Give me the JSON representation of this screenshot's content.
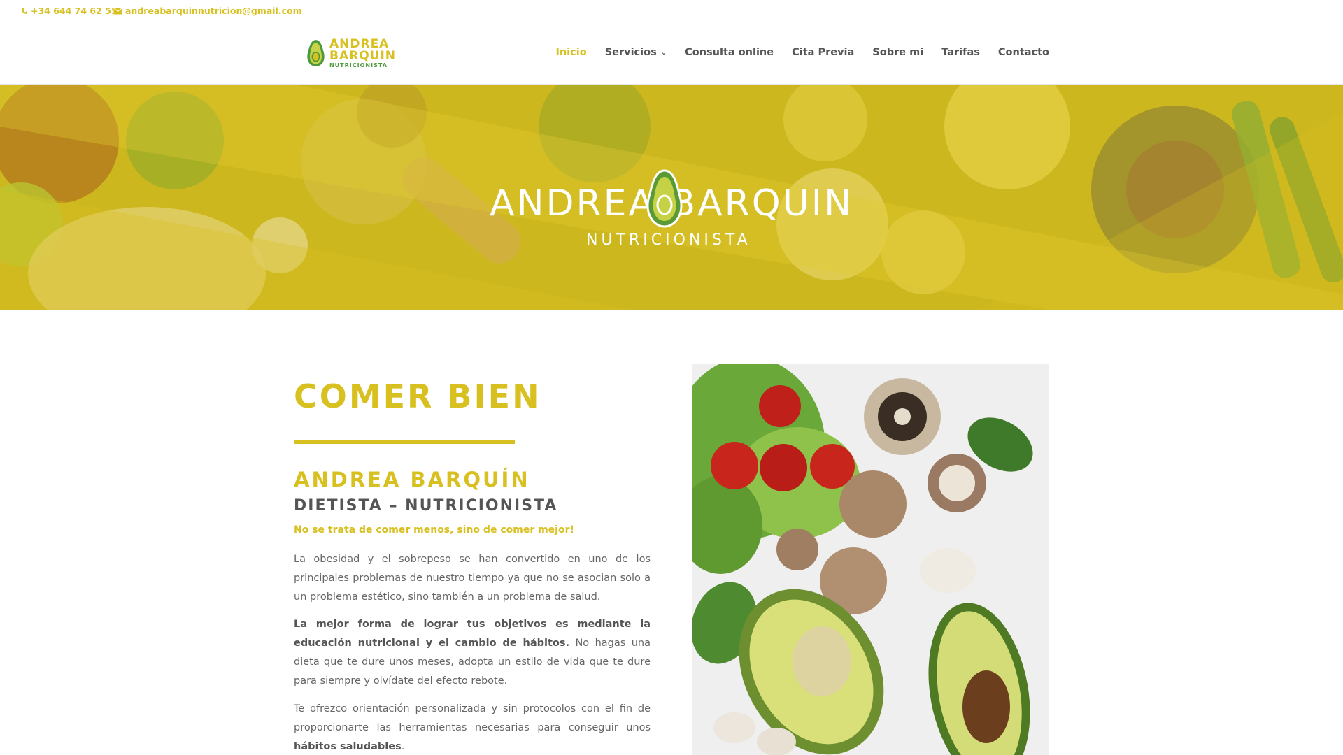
{
  "topbar": {
    "phone": "+34 644 74 62 55",
    "email": "andreabarquinnutricion@gmail.com",
    "phone_icon": "phone-icon",
    "email_icon": "envelope-icon"
  },
  "logo": {
    "line1": "ANDREA",
    "line2": "BARQUIN",
    "line3": "NUTRICIONISTA"
  },
  "nav": {
    "items": [
      {
        "label": "Inicio",
        "active": true
      },
      {
        "label": "Servicios",
        "dropdown": true
      },
      {
        "label": "Consulta online"
      },
      {
        "label": "Cita Previa"
      },
      {
        "label": "Sobre mi"
      },
      {
        "label": "Tarifas"
      },
      {
        "label": "Contacto"
      }
    ]
  },
  "hero": {
    "title_left": "ANDREA",
    "title_right": "BARQUIN",
    "subtitle": "NUTRICIONISTA"
  },
  "main": {
    "heading": "COMER BIEN",
    "name": "ANDREA BARQUÍN",
    "role": "DIETISTA – NUTRICIONISTA",
    "tagline": "No se trata de comer menos, sino de comer mejor!",
    "p1": "La obesidad y el sobrepeso se han convertido en uno de los principales problemas de nuestro tiempo ya que no se asocian solo a un problema estético, sino también a un problema de salud.",
    "p2_bold": "La mejor forma de lograr tus objetivos es mediante la educación nutricional y el cambio de hábitos.",
    "p2_rest": " No hagas una dieta que te dure unos meses, adopta un estilo de vida que te dure para siempre y olvídate del efecto rebote.",
    "p3_start": "Te ofrezco orientación personalizada y sin protocolos con el fin de proporcionarte las herramientas necesarias para conseguir unos ",
    "p3_bold": "hábitos saludables",
    "p3_end": "."
  },
  "colors": {
    "accent": "#d9c021",
    "green": "#4c9a3a",
    "text": "#666666"
  }
}
